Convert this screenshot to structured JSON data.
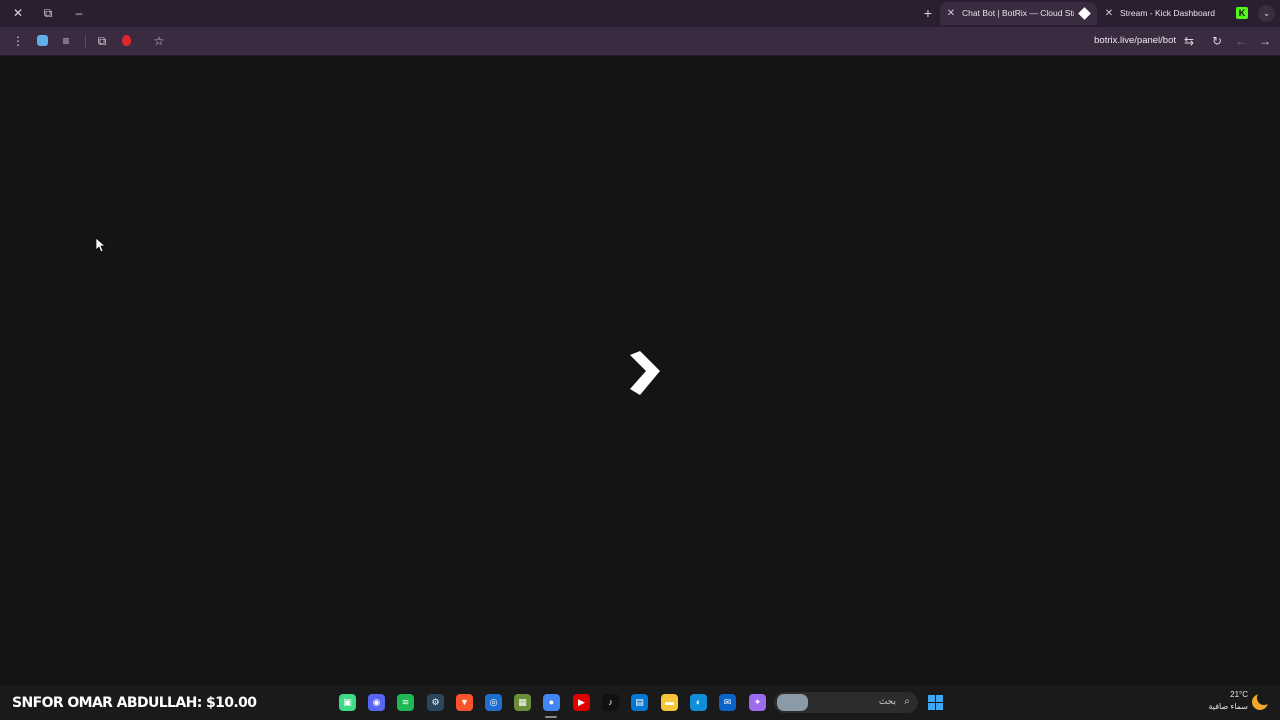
{
  "window_controls": {
    "close": "✕",
    "restore": "⧉",
    "minimize": "–"
  },
  "tabs": {
    "new_tab": "+",
    "active": {
      "title": "Chat Bot | BotRix — Cloud Stre",
      "close": "✕"
    },
    "inactive": {
      "title": "Stream - Kick Dashboard",
      "close": "✕"
    },
    "kick_favicon": "K",
    "tab_search": "⌄"
  },
  "toolbar": {
    "menu": "⋮",
    "reading_list": "≡",
    "extensions": "⧉",
    "bookmark": "☆",
    "url": "botrix.live/panel/bot",
    "site_settings": "⇆",
    "reload": "↻",
    "back": "←",
    "forward": "→"
  },
  "taskbar": {
    "donation_text": "SNFOR OMAR ABDULLAH: $10.00",
    "search_placeholder": "بحث",
    "weather_temp": "21°C",
    "weather_condition": "سماء صافية",
    "apps": [
      {
        "name": "android-app",
        "glyph": "▣",
        "color": "#3ddc84"
      },
      {
        "name": "discord",
        "glyph": "◉",
        "color": "#5865f2"
      },
      {
        "name": "spotify",
        "glyph": "≋",
        "color": "#1db954"
      },
      {
        "name": "steam",
        "glyph": "⚙",
        "color": "#2a475e"
      },
      {
        "name": "brave",
        "glyph": "▼",
        "color": "#fb542b"
      },
      {
        "name": "blue-app",
        "glyph": "◎",
        "color": "#1f6fd1"
      },
      {
        "name": "minecraft",
        "glyph": "▦",
        "color": "#6b8e3a"
      },
      {
        "name": "chrome",
        "glyph": "●",
        "color": "#4285f4"
      },
      {
        "name": "youtube",
        "glyph": "▶",
        "color": "#e00000"
      },
      {
        "name": "tiktok",
        "glyph": "♪",
        "color": "#111111"
      },
      {
        "name": "microsoft-store",
        "glyph": "▤",
        "color": "#0078d4"
      },
      {
        "name": "file-explorer",
        "glyph": "▬",
        "color": "#f8c43a"
      },
      {
        "name": "edge",
        "glyph": "◐",
        "color": "#0f8fd8"
      },
      {
        "name": "outlook",
        "glyph": "✉",
        "color": "#0a64c8"
      },
      {
        "name": "copilot",
        "glyph": "✦",
        "color": "#9b6cf0"
      }
    ]
  }
}
